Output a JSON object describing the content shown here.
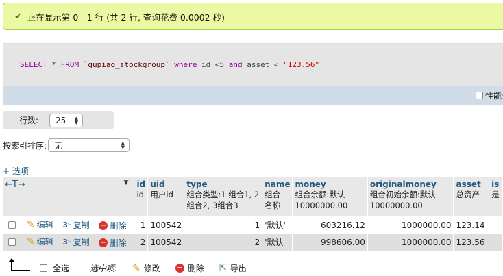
{
  "message": {
    "text": "正在显示第 0 - 1 行 (共 2 行, 查询花费 0.0002 秒)"
  },
  "sql": {
    "p1": "SELECT",
    "p2": " * ",
    "p3": "FROM",
    "p4": " ",
    "p5": "`gupiao_stockgroup`",
    "p6": " ",
    "p7": "where",
    "p8": " id <5 ",
    "p9": "and",
    "p10": " asset < ",
    "p11": "\"123.56\""
  },
  "profiling": {
    "label": "性能分"
  },
  "rows_control": {
    "label": "行数:",
    "value": "25"
  },
  "sort": {
    "label": "按索引排序:",
    "value": "无"
  },
  "options_label": "+ 选项",
  "table": {
    "nav_arrows": "←T→",
    "columns": [
      {
        "name": "id",
        "comment": "id"
      },
      {
        "name": "uid",
        "comment": "用户id"
      },
      {
        "name": "type",
        "comment": "组合类型:1 组合1, 2 组合2, 3组合3"
      },
      {
        "name": "name",
        "comment": "组合名称"
      },
      {
        "name": "money",
        "comment": "组合余额:默认10000000.00"
      },
      {
        "name": "originalmoney",
        "comment": "组合初始余额:默认10000000.00"
      },
      {
        "name": "asset",
        "comment": "总资产"
      },
      {
        "name": "is",
        "comment": "是"
      }
    ],
    "actions": {
      "edit": "编辑",
      "copy": "复制",
      "delete": "删除"
    },
    "rows": [
      {
        "id": "1",
        "uid": "100542",
        "type": "1",
        "name": "'默认'",
        "money": "603216.12",
        "originalmoney": "1000000.00",
        "asset": "123.14"
      },
      {
        "id": "2",
        "uid": "100542",
        "type": "2",
        "name": "'默认",
        "money": "998606.00",
        "originalmoney": "1000000.00",
        "asset": "123.56"
      }
    ]
  },
  "bottom": {
    "select_all": "全选",
    "selected_label": "选中项:",
    "modify": "修改",
    "delete": "删除",
    "export": "导出"
  }
}
